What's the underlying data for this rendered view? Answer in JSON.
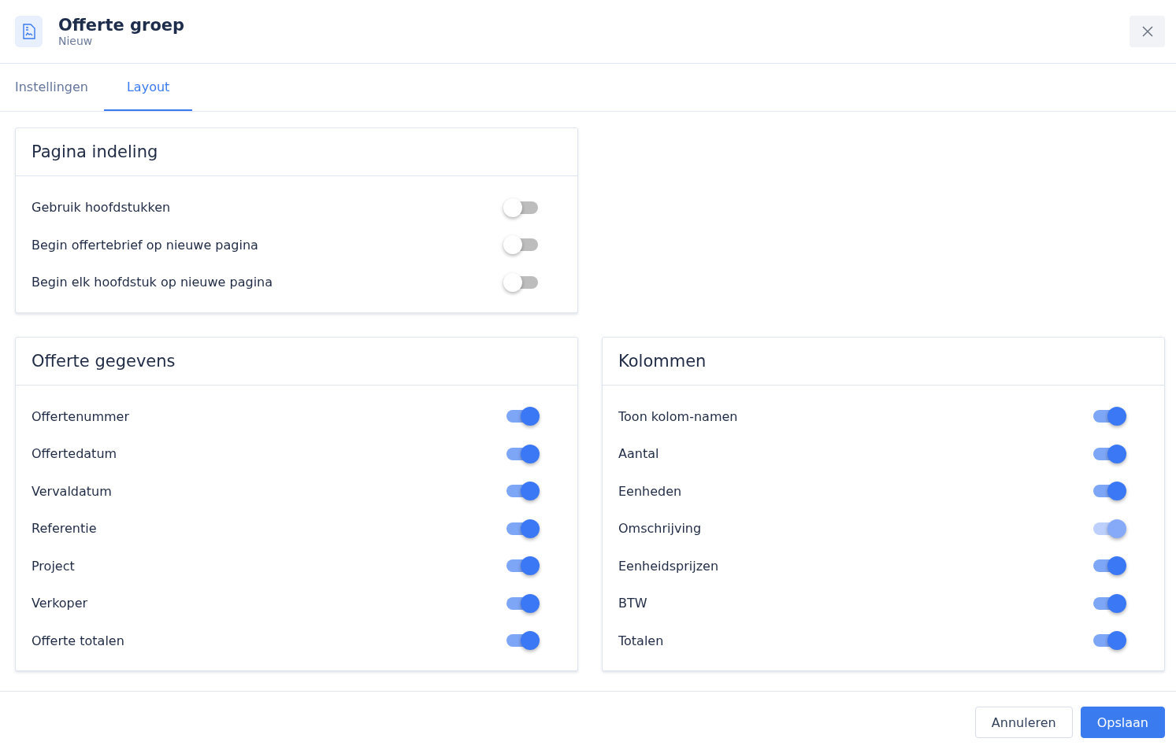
{
  "header": {
    "title": "Offerte groep",
    "subtitle": "Nieuw"
  },
  "tabs": [
    {
      "label": "Instellingen",
      "selected": false
    },
    {
      "label": "Layout",
      "selected": true
    }
  ],
  "cards": [
    {
      "title": "Pagina indeling",
      "settings": [
        {
          "label": "Gebruik hoofdstukken",
          "on": false,
          "disabled": false
        },
        {
          "label": "Begin offertebrief op nieuwe pagina",
          "on": false,
          "disabled": false
        },
        {
          "label": "Begin elk hoofdstuk op nieuwe pagina",
          "on": false,
          "disabled": false
        }
      ]
    },
    {
      "title": "Offerte gegevens",
      "settings": [
        {
          "label": "Offertenummer",
          "on": true,
          "disabled": false
        },
        {
          "label": "Offertedatum",
          "on": true,
          "disabled": false
        },
        {
          "label": "Vervaldatum",
          "on": true,
          "disabled": false
        },
        {
          "label": "Referentie",
          "on": true,
          "disabled": false
        },
        {
          "label": "Project",
          "on": true,
          "disabled": false
        },
        {
          "label": "Verkoper",
          "on": true,
          "disabled": false
        },
        {
          "label": "Offerte totalen",
          "on": true,
          "disabled": false
        }
      ]
    },
    {
      "title": "Kolommen",
      "settings": [
        {
          "label": "Toon kolom-namen",
          "on": true,
          "disabled": false
        },
        {
          "label": "Aantal",
          "on": true,
          "disabled": false
        },
        {
          "label": "Eenheden",
          "on": true,
          "disabled": false
        },
        {
          "label": "Omschrijving",
          "on": true,
          "disabled": true
        },
        {
          "label": "Eenheidsprijzen",
          "on": true,
          "disabled": false
        },
        {
          "label": "BTW",
          "on": true,
          "disabled": false
        },
        {
          "label": "Totalen",
          "on": true,
          "disabled": false
        }
      ]
    }
  ],
  "buttons": {
    "cancel": "Annuleren",
    "save": "Opslaan"
  }
}
